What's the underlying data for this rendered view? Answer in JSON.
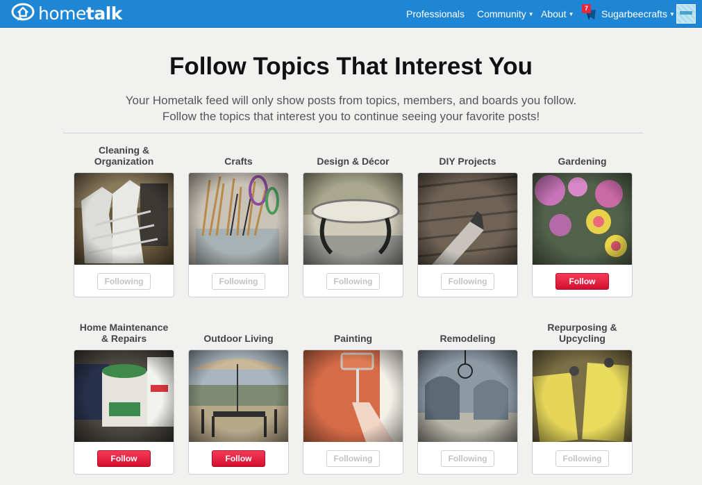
{
  "header": {
    "logo_text_light": "home",
    "logo_text_bold": "talk",
    "nav": {
      "professionals": "Professionals",
      "community": "Community",
      "about": "About",
      "user": "Sugarbeecrafts"
    },
    "notification_count": "7",
    "brand_color": "#1e86d4"
  },
  "main": {
    "title": "Follow Topics That Interest You",
    "subtitle_line1": "Your Hometalk feed will only show posts from topics, members, and boards you follow.",
    "subtitle_line2": "Follow the topics that interest you to continue seeing your favorite posts!"
  },
  "topics": [
    {
      "label_lines": [
        "Cleaning &",
        "Organization"
      ],
      "button": "Following",
      "state": "following"
    },
    {
      "label_lines": [
        "Crafts"
      ],
      "button": "Following",
      "state": "following"
    },
    {
      "label_lines": [
        "Design & Décor"
      ],
      "button": "Following",
      "state": "following"
    },
    {
      "label_lines": [
        "DIY Projects"
      ],
      "button": "Following",
      "state": "following"
    },
    {
      "label_lines": [
        "Gardening"
      ],
      "button": "Follow",
      "state": "follow"
    },
    {
      "label_lines": [
        "Home Maintenance",
        "& Repairs"
      ],
      "button": "Follow",
      "state": "follow"
    },
    {
      "label_lines": [
        "Outdoor Living"
      ],
      "button": "Follow",
      "state": "follow"
    },
    {
      "label_lines": [
        "Painting"
      ],
      "button": "Following",
      "state": "following"
    },
    {
      "label_lines": [
        "Remodeling"
      ],
      "button": "Following",
      "state": "following"
    },
    {
      "label_lines": [
        "Repurposing &",
        "Upcycling"
      ],
      "button": "Following",
      "state": "following"
    }
  ],
  "colors": {
    "follow_button": "#e5203f",
    "following_text": "#c2c2c2"
  }
}
